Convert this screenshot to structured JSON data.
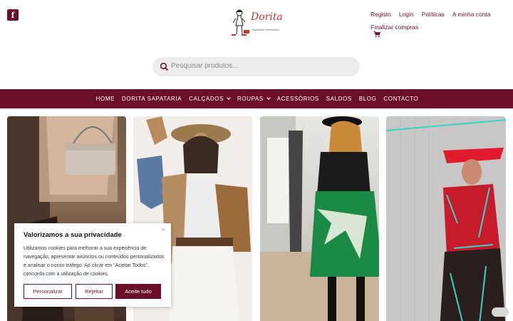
{
  "header": {
    "social_icon": "facebook-icon",
    "logo_script": "Dorita",
    "logo_sub": "Sapataria e Acessórios",
    "top_links": [
      "Registo",
      "Login",
      "Políticas",
      "A minha conta"
    ],
    "checkout": "Finalizar compras",
    "cart_icon": "cart-icon"
  },
  "search": {
    "placeholder": "Pesquisar produtos..."
  },
  "nav": {
    "items": [
      {
        "label": "HOME"
      },
      {
        "label": "DORITA SAPATARIA"
      },
      {
        "label": "CALÇADOS"
      },
      {
        "label": "ROUPAS"
      },
      {
        "label": "ACESSÓRIOS"
      },
      {
        "label": "SALDOS"
      },
      {
        "label": "BLOG"
      },
      {
        "label": "CONTACTO"
      }
    ]
  },
  "cookie": {
    "title": "Valorizamos a sua privacidade",
    "close": "×",
    "text": "Utilizamos cookies para melhorar a sua experiência de navegação, apresentar anúncios ou conteúdos personalizados e analisar o nosso tráfego. Ao clicar em \"Aceitar Todos\", concorda com a utilização de cookies.",
    "customize": "Personalizar",
    "reject": "Rejeitar",
    "accept": "Aceite tudo"
  },
  "colors": {
    "brand": "#6b0f2a",
    "accent_red": "#c0392b"
  }
}
